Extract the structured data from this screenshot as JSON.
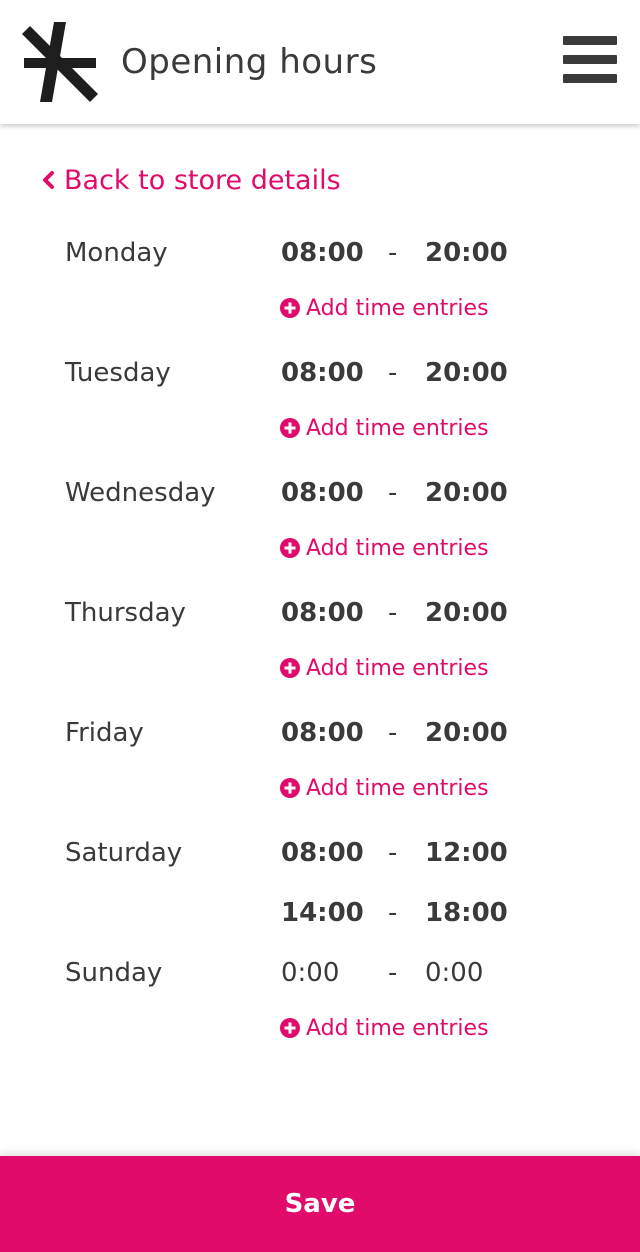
{
  "header": {
    "title": "Opening hours",
    "logo_icon": "asterisk-logo-icon",
    "menu_icon": "hamburger-menu-icon"
  },
  "back_link": {
    "label": "Back to store details",
    "icon": "chevron-left-icon"
  },
  "add_entry_label": "Add time entries",
  "days": [
    {
      "name": "Monday",
      "entries": [
        {
          "start": "08:00",
          "end": "20:00"
        }
      ],
      "show_add": true,
      "active": true
    },
    {
      "name": "Tuesday",
      "entries": [
        {
          "start": "08:00",
          "end": "20:00"
        }
      ],
      "show_add": true,
      "active": true
    },
    {
      "name": "Wednesday",
      "entries": [
        {
          "start": "08:00",
          "end": "20:00"
        }
      ],
      "show_add": true,
      "active": true
    },
    {
      "name": "Thursday",
      "entries": [
        {
          "start": "08:00",
          "end": "20:00"
        }
      ],
      "show_add": true,
      "active": true
    },
    {
      "name": "Friday",
      "entries": [
        {
          "start": "08:00",
          "end": "20:00"
        }
      ],
      "show_add": true,
      "active": true
    },
    {
      "name": "Saturday",
      "entries": [
        {
          "start": "08:00",
          "end": "12:00"
        },
        {
          "start": "14:00",
          "end": "18:00"
        }
      ],
      "show_add": false,
      "active": true
    },
    {
      "name": "Sunday",
      "entries": [
        {
          "start": "0:00",
          "end": "0:00"
        }
      ],
      "show_add": true,
      "active": false
    }
  ],
  "dash": "-",
  "save_label": "Save",
  "colors": {
    "accent": "#e00b6a",
    "text": "#3a3a3a",
    "background": "#ffffff"
  }
}
